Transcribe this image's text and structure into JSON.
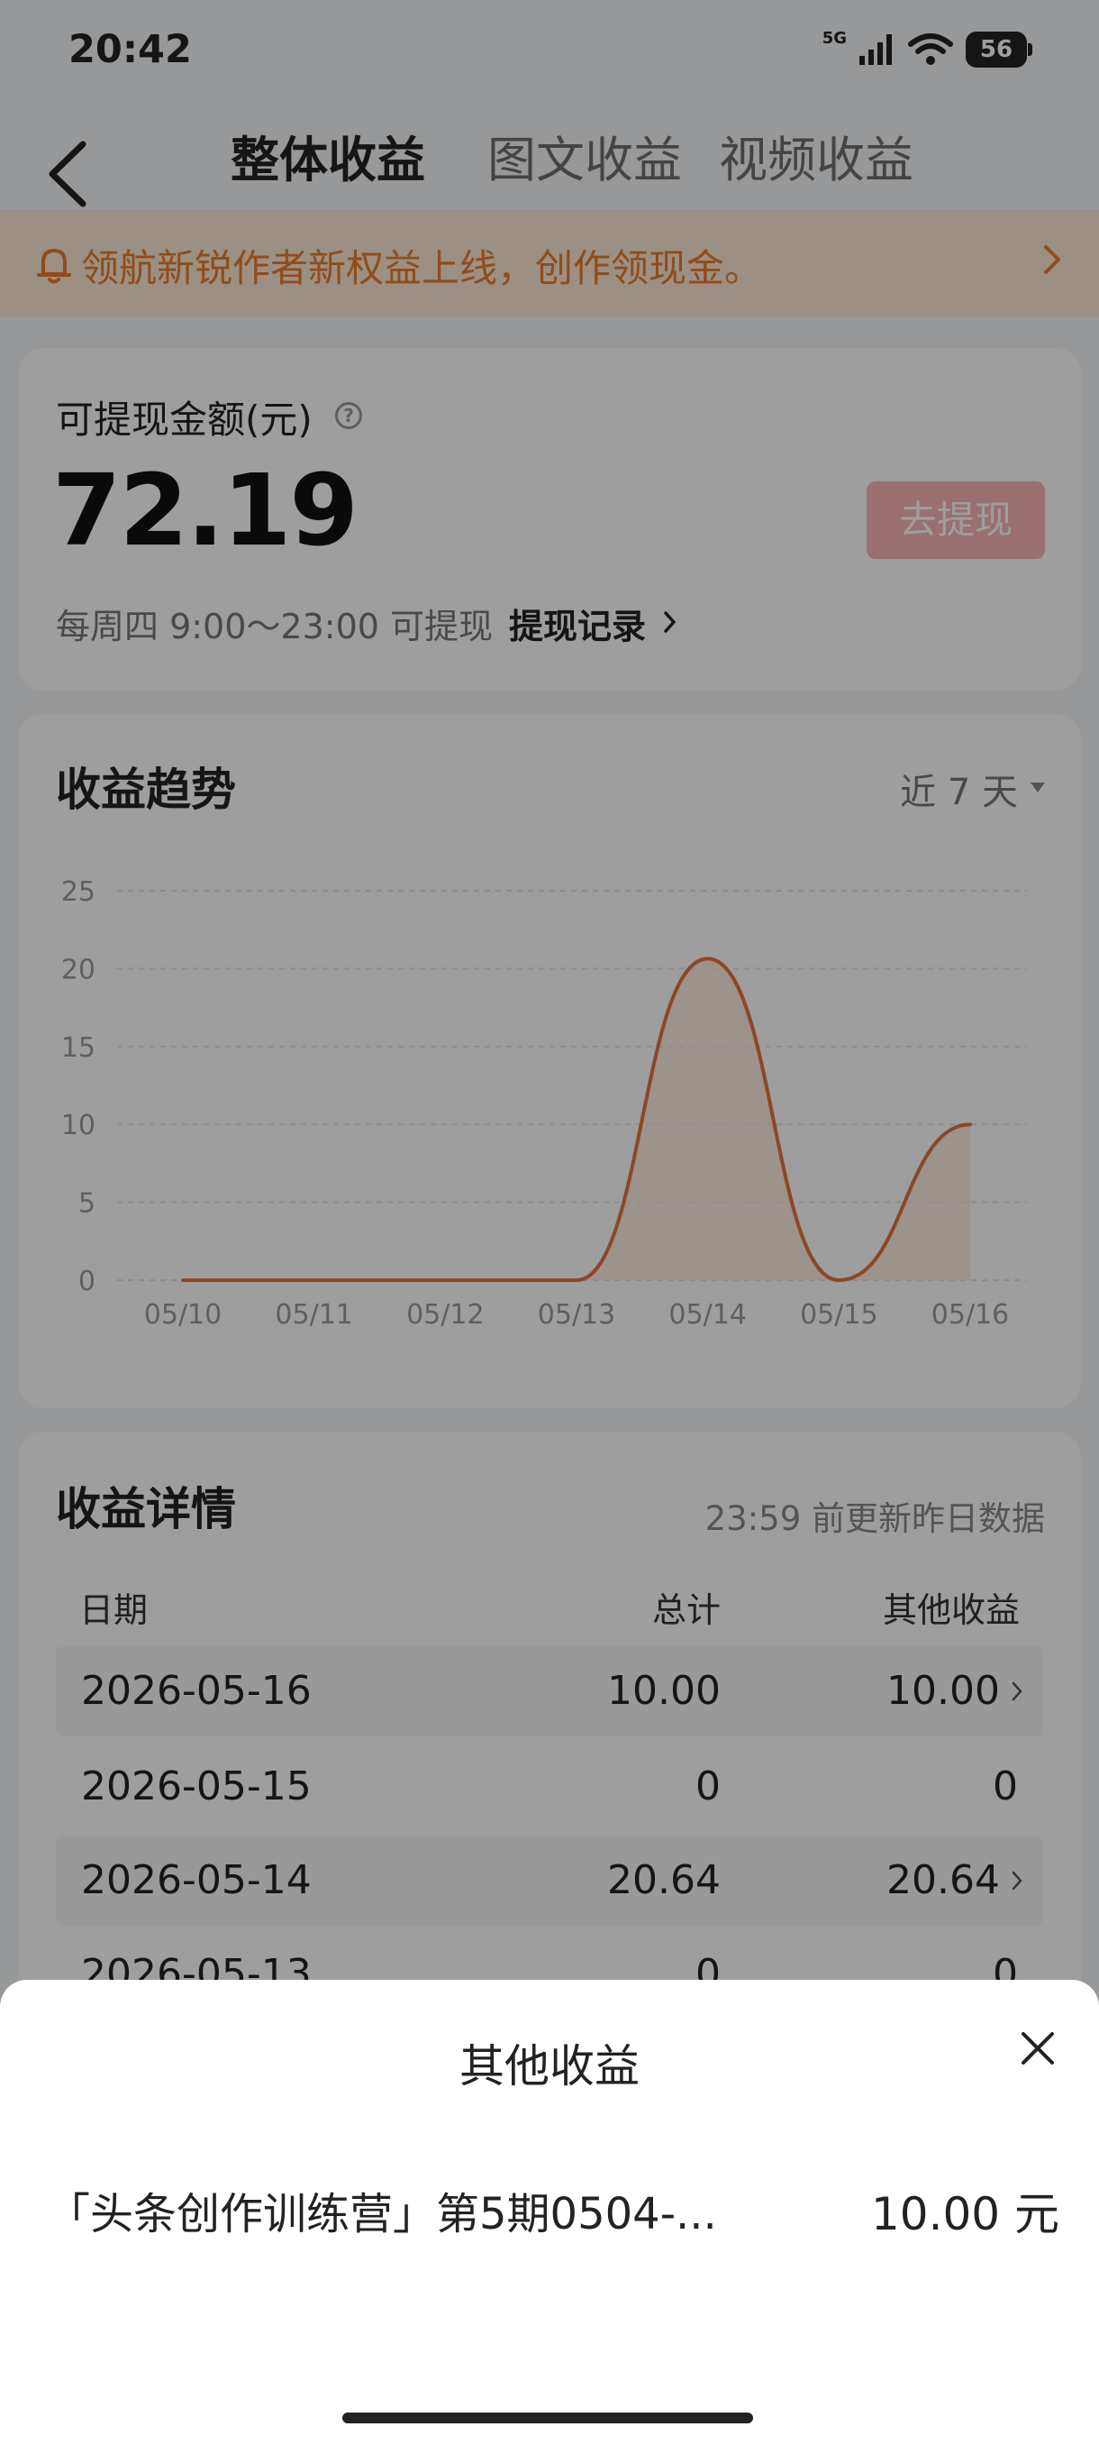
{
  "status_bar": {
    "time": "20:42",
    "network": "5G",
    "battery": "56"
  },
  "nav": {
    "tabs": [
      {
        "label": "整体收益",
        "active": true
      },
      {
        "label": "图文收益",
        "active": false
      },
      {
        "label": "视频收益",
        "active": false
      }
    ]
  },
  "banner": {
    "text": "领航新锐作者新权益上线，创作领现金。"
  },
  "balance": {
    "label": "可提现金额(元)",
    "amount": "72.19",
    "withdraw_label": "去提现",
    "hint": "每周四 9:00～23:00 可提现",
    "record_label": "提现记录"
  },
  "trend": {
    "title": "收益趋势",
    "range_label": "近 7 天"
  },
  "chart_data": {
    "type": "line",
    "x": [
      "05/10",
      "05/11",
      "05/12",
      "05/13",
      "05/14",
      "05/15",
      "05/16"
    ],
    "series": [
      {
        "values": [
          0,
          0,
          0,
          0,
          20.64,
          0,
          10.0
        ]
      }
    ],
    "ylim": [
      0,
      25
    ],
    "yticks": [
      0,
      5,
      10,
      15,
      20,
      25
    ],
    "grid": true,
    "line_color": "#e5733b",
    "fill_color": "#fbe6d8"
  },
  "details": {
    "title": "收益详情",
    "note": "23:59 前更新昨日数据",
    "headers": {
      "date": "日期",
      "total": "总计",
      "other": "其他收益"
    },
    "rows": [
      {
        "date": "2026-05-16",
        "total": "10.00",
        "other": "10.00"
      },
      {
        "date": "2026-05-15",
        "total": "0",
        "other": "0"
      },
      {
        "date": "2026-05-14",
        "total": "20.64",
        "other": "20.64"
      },
      {
        "date": "2026-05-13",
        "total": "0",
        "other": "0"
      }
    ]
  },
  "sheet": {
    "title": "其他收益",
    "item_name": "「头条创作训练营」第5期0504-...",
    "item_amount": "10.00 元"
  }
}
